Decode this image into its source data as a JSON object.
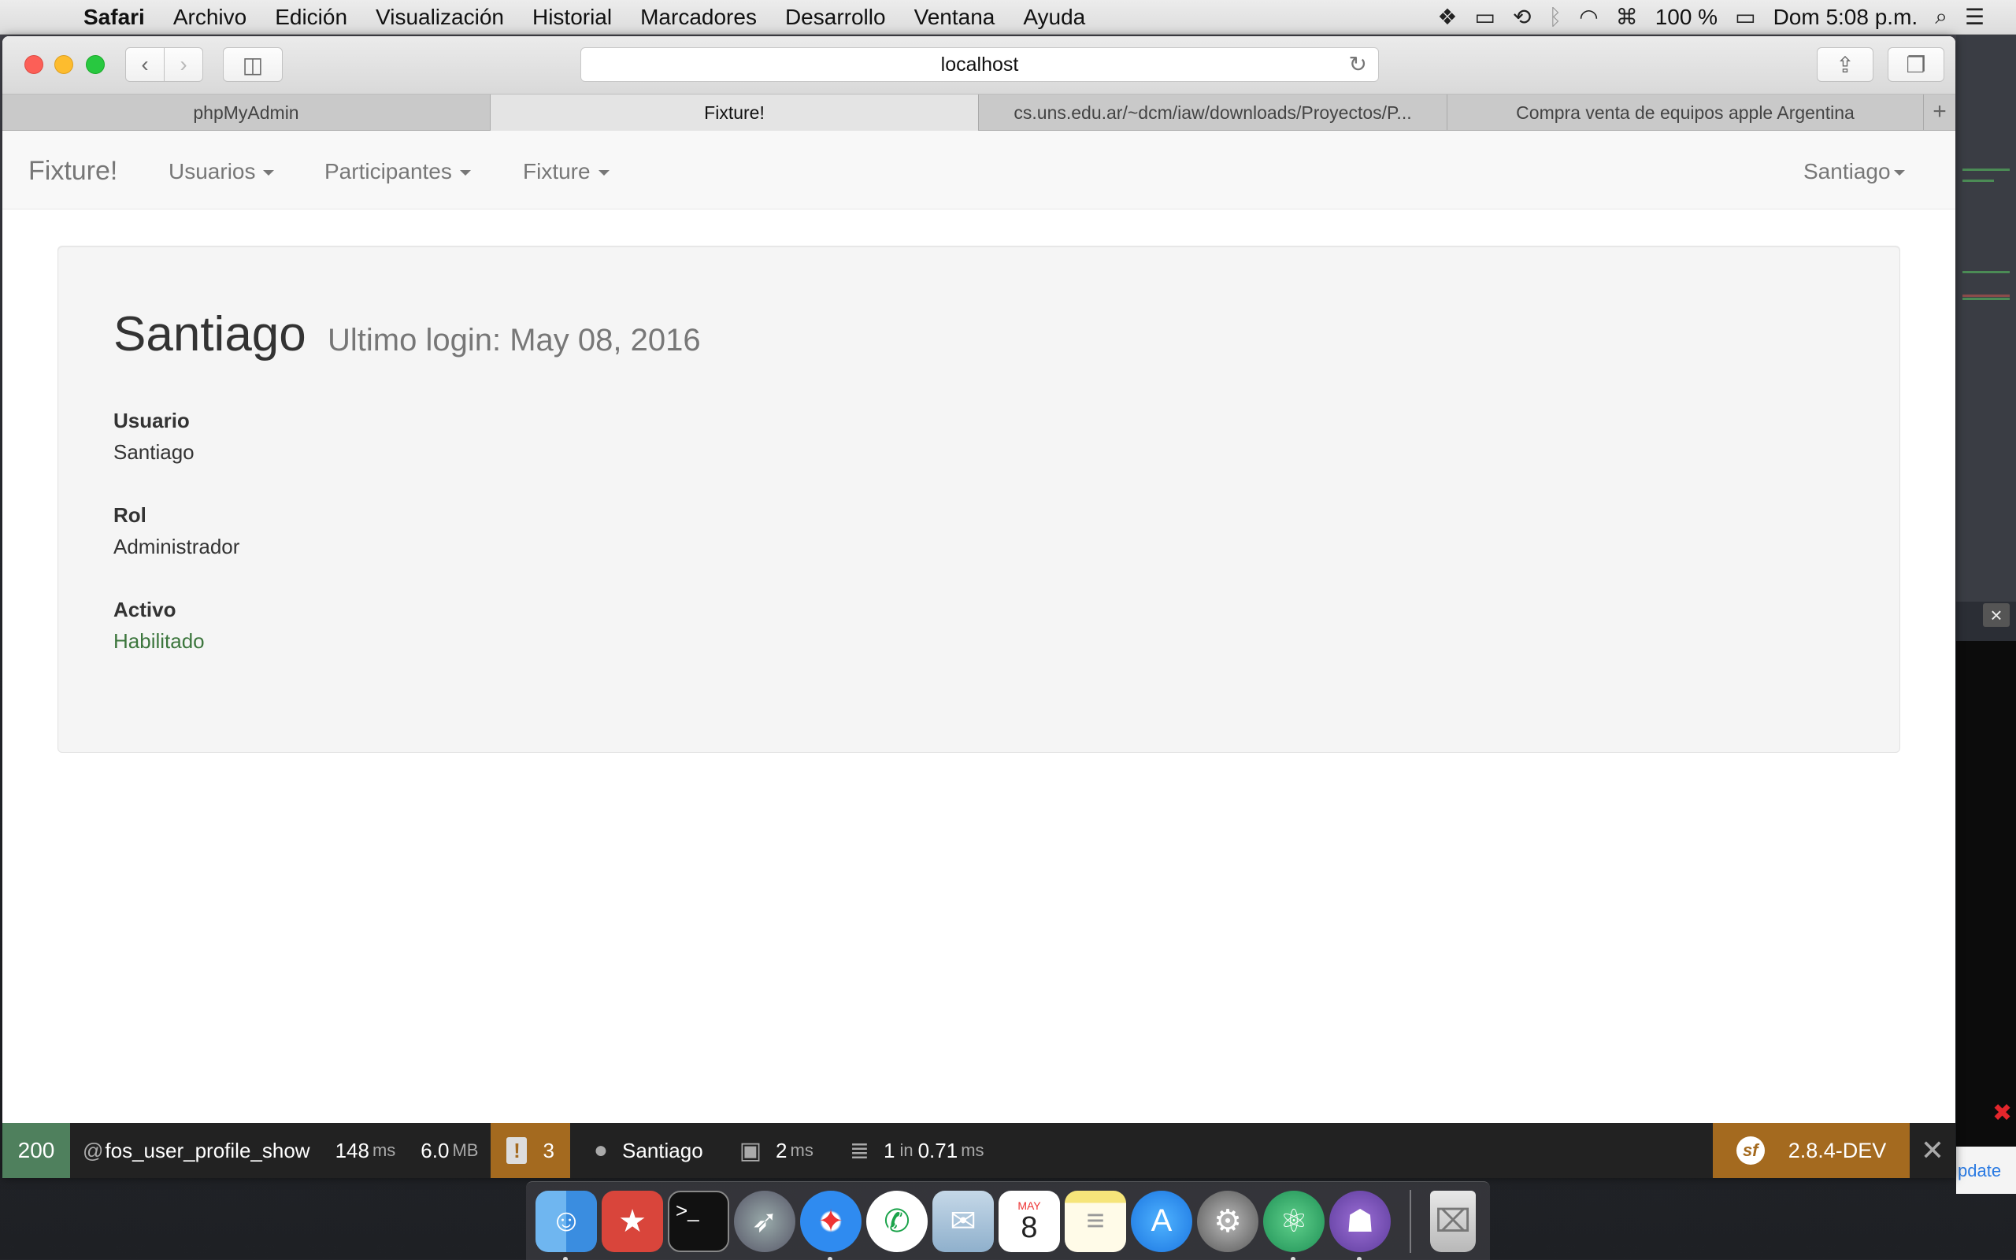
{
  "menubar": {
    "app_name": "Safari",
    "items": [
      "Archivo",
      "Edición",
      "Visualización",
      "Historial",
      "Marcadores",
      "Desarrollo",
      "Ventana",
      "Ayuda"
    ],
    "battery": "100 %",
    "clock": "Dom 5:08 p.m."
  },
  "browser": {
    "url": "localhost",
    "tabs": [
      {
        "label": "phpMyAdmin"
      },
      {
        "label": "Fixture!"
      },
      {
        "label": "cs.uns.edu.ar/~dcm/iaw/downloads/Proyectos/P..."
      },
      {
        "label": "Compra venta de equipos apple Argentina"
      }
    ],
    "active_tab": 1
  },
  "navbar": {
    "brand": "Fixture!",
    "items": [
      "Usuarios",
      "Participantes",
      "Fixture"
    ],
    "user": "Santiago"
  },
  "profile": {
    "name": "Santiago",
    "last_login": "Ultimo login: May 08, 2016",
    "fields": [
      {
        "label": "Usuario",
        "value": "Santiago"
      },
      {
        "label": "Rol",
        "value": "Administrador"
      },
      {
        "label": "Activo",
        "value": "Habilitado"
      }
    ]
  },
  "debug_toolbar": {
    "status": "200",
    "route_prefix": "@",
    "route": "fos_user_profile_show",
    "time_value": "148",
    "time_unit": "ms",
    "memory_value": "6.0",
    "memory_unit": "MB",
    "warnings": "3",
    "user": "Santiago",
    "render_value": "2",
    "render_unit": "ms",
    "db_queries": "1",
    "db_in": "in",
    "db_time": "0.71",
    "db_unit": "ms",
    "version": "2.8.4-DEV"
  },
  "side_strip": {
    "update_text": "pdate"
  },
  "dock": {
    "apps": [
      "finder-icon",
      "wunderlist-icon",
      "terminal-icon",
      "launchpad-icon",
      "safari-icon",
      "phone-icon",
      "mail-icon",
      "calendar-icon",
      "notes-icon",
      "app-store-icon",
      "system-preferences-icon",
      "atom-icon",
      "github-icon",
      "trash-icon"
    ],
    "calendar_month": "MAY",
    "calendar_day": "8"
  },
  "colors": {
    "success": "#3c763d",
    "sf_status": "#4f805d",
    "sf_accent": "#a46a1f"
  }
}
